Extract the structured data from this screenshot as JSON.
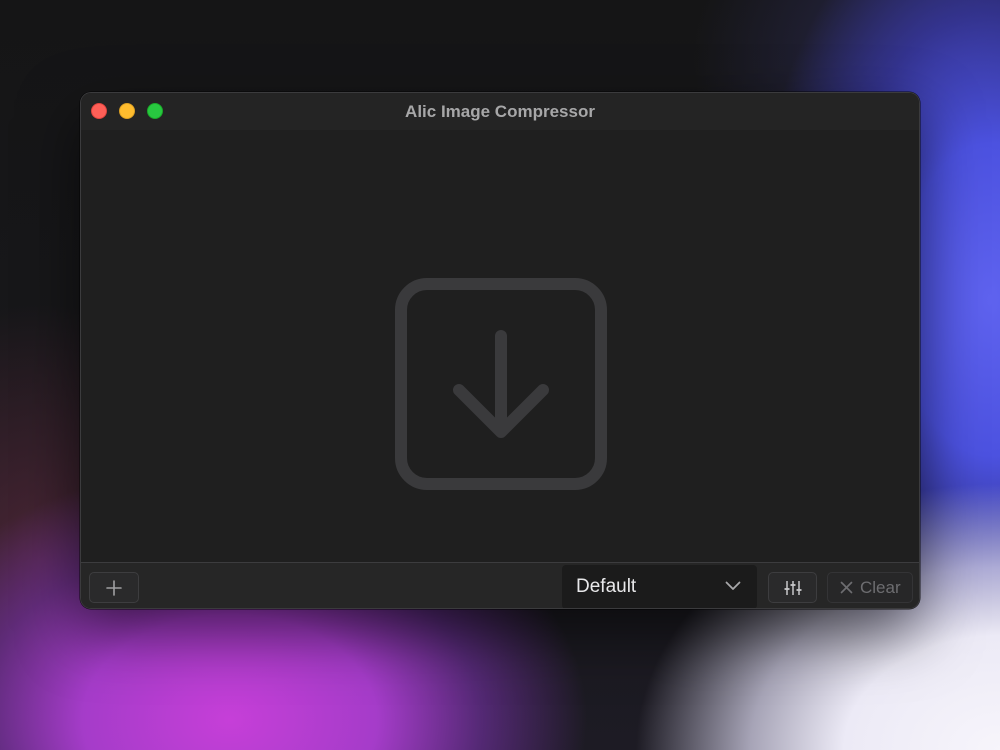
{
  "window": {
    "title": "Alic Image Compressor"
  },
  "drop_area": {
    "icon": "download-arrow-in-square-icon"
  },
  "toolbar": {
    "add_icon": "plus-icon",
    "preset": {
      "selected": "Default",
      "icon": "chevron-down-icon"
    },
    "settings_icon": "sliders-icon",
    "clear": {
      "label": "Clear",
      "icon": "x-icon"
    }
  },
  "colors": {
    "close": "#fe5f57",
    "minimize": "#febc2e",
    "maximize": "#28c840",
    "window_bg": "#1f1f1f",
    "icon_muted": "#3a3a3c"
  }
}
